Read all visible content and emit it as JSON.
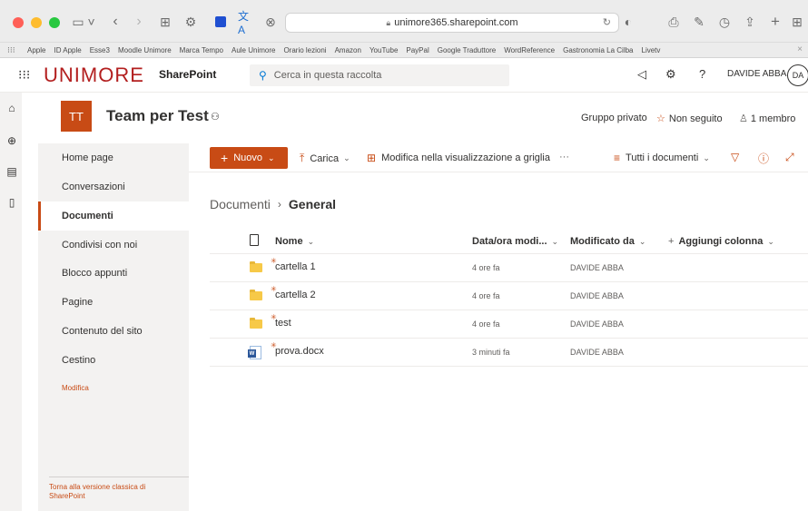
{
  "browser": {
    "url": "unimore365.sharepoint.com",
    "favorites": [
      "Apple",
      "ID Apple",
      "Esse3",
      "Moodle Unimore",
      "Marca Tempo",
      "Aule Unimore",
      "Orario lezioni",
      "Amazon",
      "YouTube",
      "PayPal",
      "Google Traduttore",
      "WordReference",
      "Gastronomia La Cilba",
      "Livetv"
    ]
  },
  "suite": {
    "brand": "UNIMORE",
    "app_name": "SharePoint",
    "search_placeholder": "Cerca in questa raccolta",
    "user_name": "DAVIDE ABBA",
    "user_initials": "DA"
  },
  "site": {
    "logo_initials": "TT",
    "title": "Team per Test",
    "privacy": "Gruppo privato",
    "follow_label": "Non seguito",
    "members_label": "1 membro"
  },
  "nav": {
    "items": [
      "Home page",
      "Conversazioni",
      "Documenti",
      "Condivisi con noi",
      "Blocco appunti",
      "Pagine",
      "Contenuto del sito",
      "Cestino"
    ],
    "selected": "Documenti",
    "edit_label": "Modifica",
    "classic_label": "Torna alla versione classica di SharePoint"
  },
  "commands": {
    "new_label": "Nuovo",
    "upload_label": "Carica",
    "grid_edit_label": "Modifica nella visualizzazione a griglia",
    "more_label": "···",
    "view_label": "Tutti i documenti"
  },
  "breadcrumb": {
    "parent": "Documenti",
    "current": "General"
  },
  "columns": {
    "name": "Nome",
    "modified": "Data/ora modi...",
    "modified_by": "Modificato da",
    "add_column": "Aggiungi colonna"
  },
  "files": [
    {
      "name": "cartella 1",
      "type": "folder",
      "modified": "4 ore fa",
      "modified_by": "DAVIDE ABBA"
    },
    {
      "name": "cartella 2",
      "type": "folder",
      "modified": "4 ore fa",
      "modified_by": "DAVIDE ABBA"
    },
    {
      "name": "test",
      "type": "folder",
      "modified": "4 ore fa",
      "modified_by": "DAVIDE ABBA"
    },
    {
      "name": "prova.docx",
      "type": "word",
      "modified": "3 minuti fa",
      "modified_by": "DAVIDE ABBA"
    }
  ],
  "colors": {
    "accent": "#c84b15",
    "brand": "#b31f1f"
  }
}
